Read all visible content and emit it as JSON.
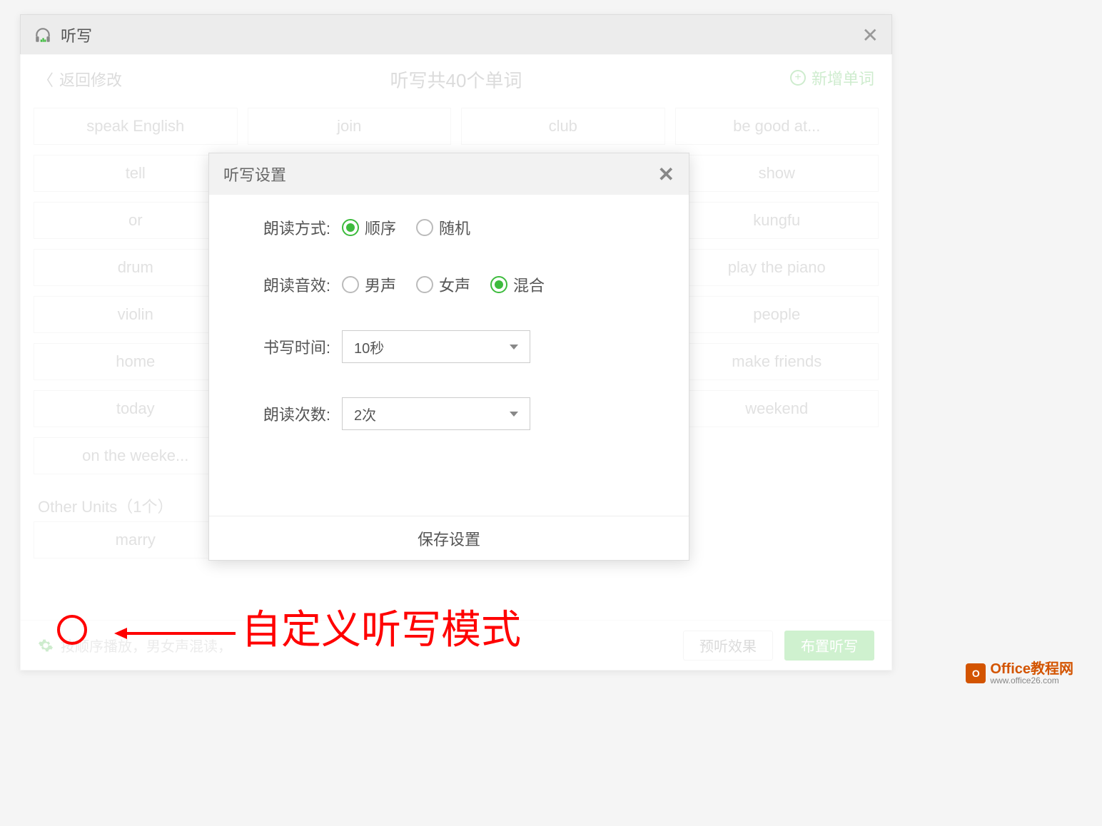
{
  "outer": {
    "title": "听写",
    "back_label": "返回修改",
    "center_title": "听写共40个单词",
    "add_word_label": "新增单词",
    "section_label": "Other Units（1个）"
  },
  "words_row1": [
    "speak English",
    "join",
    "club",
    "be good at..."
  ],
  "words_col1": [
    "tell",
    "or",
    "drum",
    "violin",
    "home",
    "today",
    "on the weeke..."
  ],
  "words_col4": [
    "show",
    "kungfu",
    "play the piano",
    "people",
    "make friends",
    "weekend"
  ],
  "words_bottom": [
    "marry"
  ],
  "footer": {
    "settings_text": "按顺序播放，男女声混读，",
    "preview_btn": "预听效果",
    "assign_btn": "布置听写"
  },
  "dialog": {
    "title": "听写设置",
    "reading_mode_label": "朗读方式:",
    "reading_mode_options": [
      "顺序",
      "随机"
    ],
    "reading_mode_selected": "顺序",
    "voice_label": "朗读音效:",
    "voice_options": [
      "男声",
      "女声",
      "混合"
    ],
    "voice_selected": "混合",
    "write_time_label": "书写时间:",
    "write_time_value": "10秒",
    "read_count_label": "朗读次数:",
    "read_count_value": "2次",
    "save_btn": "保存设置"
  },
  "annotation": {
    "text": "自定义听写模式"
  },
  "watermark": {
    "title": "Office教程网",
    "url": "www.office26.com"
  }
}
